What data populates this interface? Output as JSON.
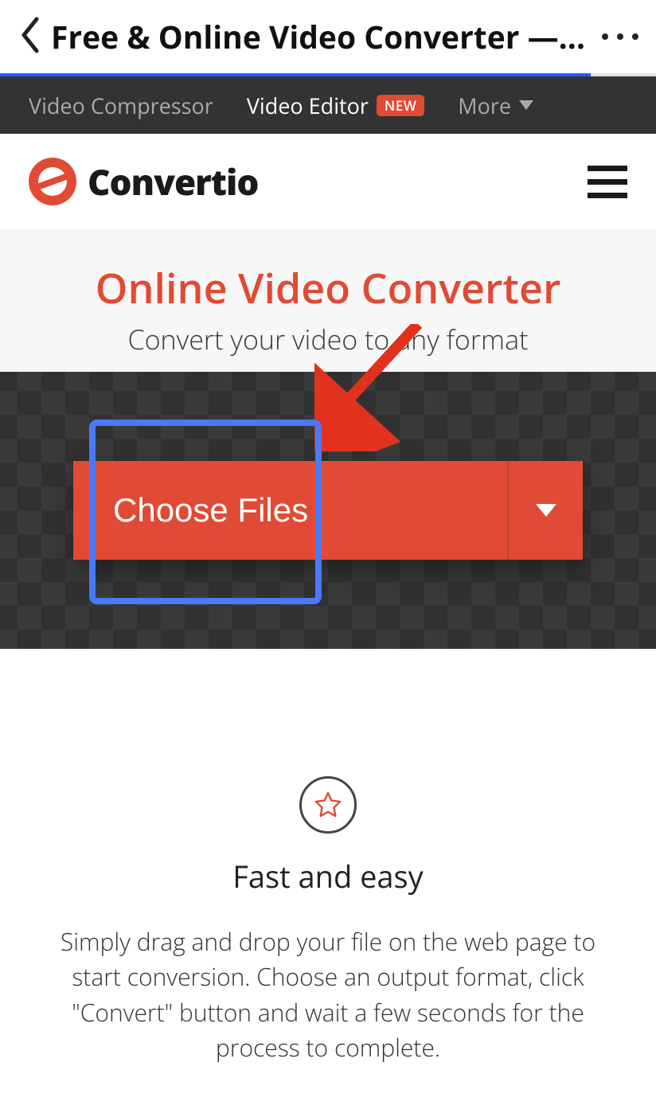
{
  "chrome": {
    "title": "Free & Online Video Converter — Co..."
  },
  "topnav": {
    "compressor": "Video Compressor",
    "editor": "Video Editor",
    "badge": "NEW",
    "more": "More"
  },
  "brand": {
    "name": "Convertio"
  },
  "hero": {
    "title": "Online Video Converter",
    "subtitle": "Convert your video to any format"
  },
  "upload": {
    "choose": "Choose Files"
  },
  "feature": {
    "title": "Fast and easy",
    "body": "Simply drag and drop your file on the web page to start conversion. Choose an output format, click \"Convert\" button and wait a few seconds for the process to complete."
  }
}
